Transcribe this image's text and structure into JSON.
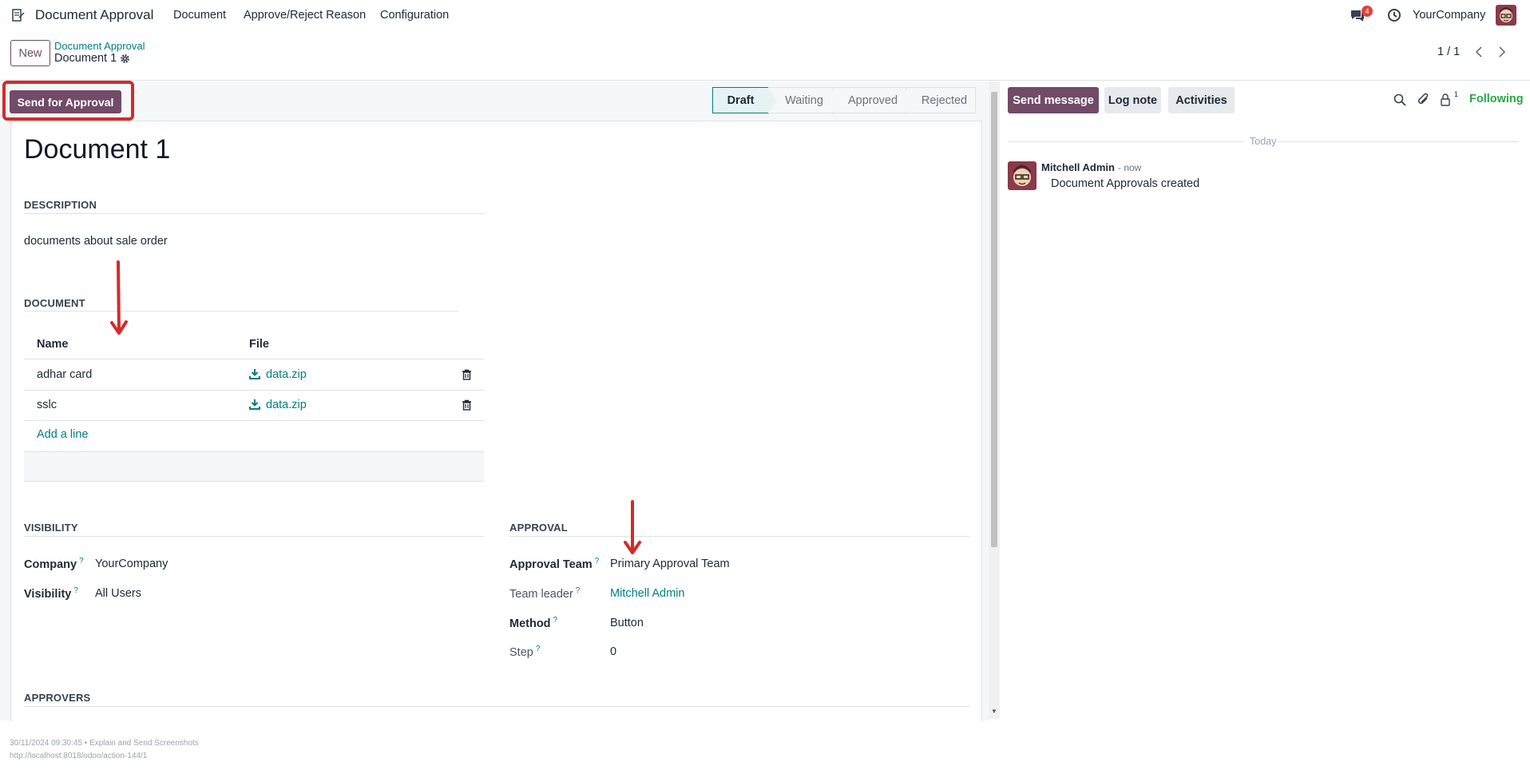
{
  "navbar": {
    "app_name": "Document Approval",
    "menu": [
      "Document",
      "Approve/Reject Reason",
      "Configuration"
    ],
    "message_count": "4",
    "company": "YourCompany"
  },
  "control_panel": {
    "new_label": "New",
    "breadcrumb_parent": "Document Approval",
    "breadcrumb_current": "Document 1",
    "pager": "1 / 1"
  },
  "statusbar": {
    "action_label": "Send for Approval",
    "stages": [
      "Draft",
      "Waiting",
      "Approved",
      "Rejected"
    ],
    "active_stage": "Draft"
  },
  "form": {
    "title": "Document 1",
    "description_section": "DESCRIPTION",
    "description": "documents about sale order",
    "document_section": "DOCUMENT",
    "columns": [
      "Name",
      "File"
    ],
    "rows": [
      {
        "name": "adhar card",
        "file": "data.zip"
      },
      {
        "name": "sslc",
        "file": "data.zip"
      }
    ],
    "add_line": "Add a line",
    "visibility_section": "VISIBILITY",
    "company_label": "Company",
    "company_value": "YourCompany",
    "visibility_label": "Visibility",
    "visibility_value": "All Users",
    "approval_section": "APPROVAL",
    "approval_team_label": "Approval Team",
    "approval_team_value": "Primary Approval Team",
    "team_leader_label": "Team leader",
    "team_leader_value": "Mitchell Admin",
    "method_label": "Method",
    "method_value": "Button",
    "step_label": "Step",
    "step_value": "0",
    "approvers_section": "APPROVERS",
    "help_mark": "?"
  },
  "chatter": {
    "send_message": "Send message",
    "log_note": "Log note",
    "activities": "Activities",
    "follower_count": "1",
    "following": "Following",
    "date_separator": "Today",
    "messages": [
      {
        "author": "Mitchell Admin",
        "time": "- now",
        "body": "Document Approvals created"
      }
    ]
  },
  "footer": {
    "line1": "30/11/2024 09:30:45 • Explain and Send Screenshots",
    "line2": "http://localhost:8018/odoo/action-144/1"
  },
  "colors": {
    "brand": "#714b67",
    "link": "#017e84",
    "annotation": "#d42a2a",
    "following": "#28a745"
  }
}
